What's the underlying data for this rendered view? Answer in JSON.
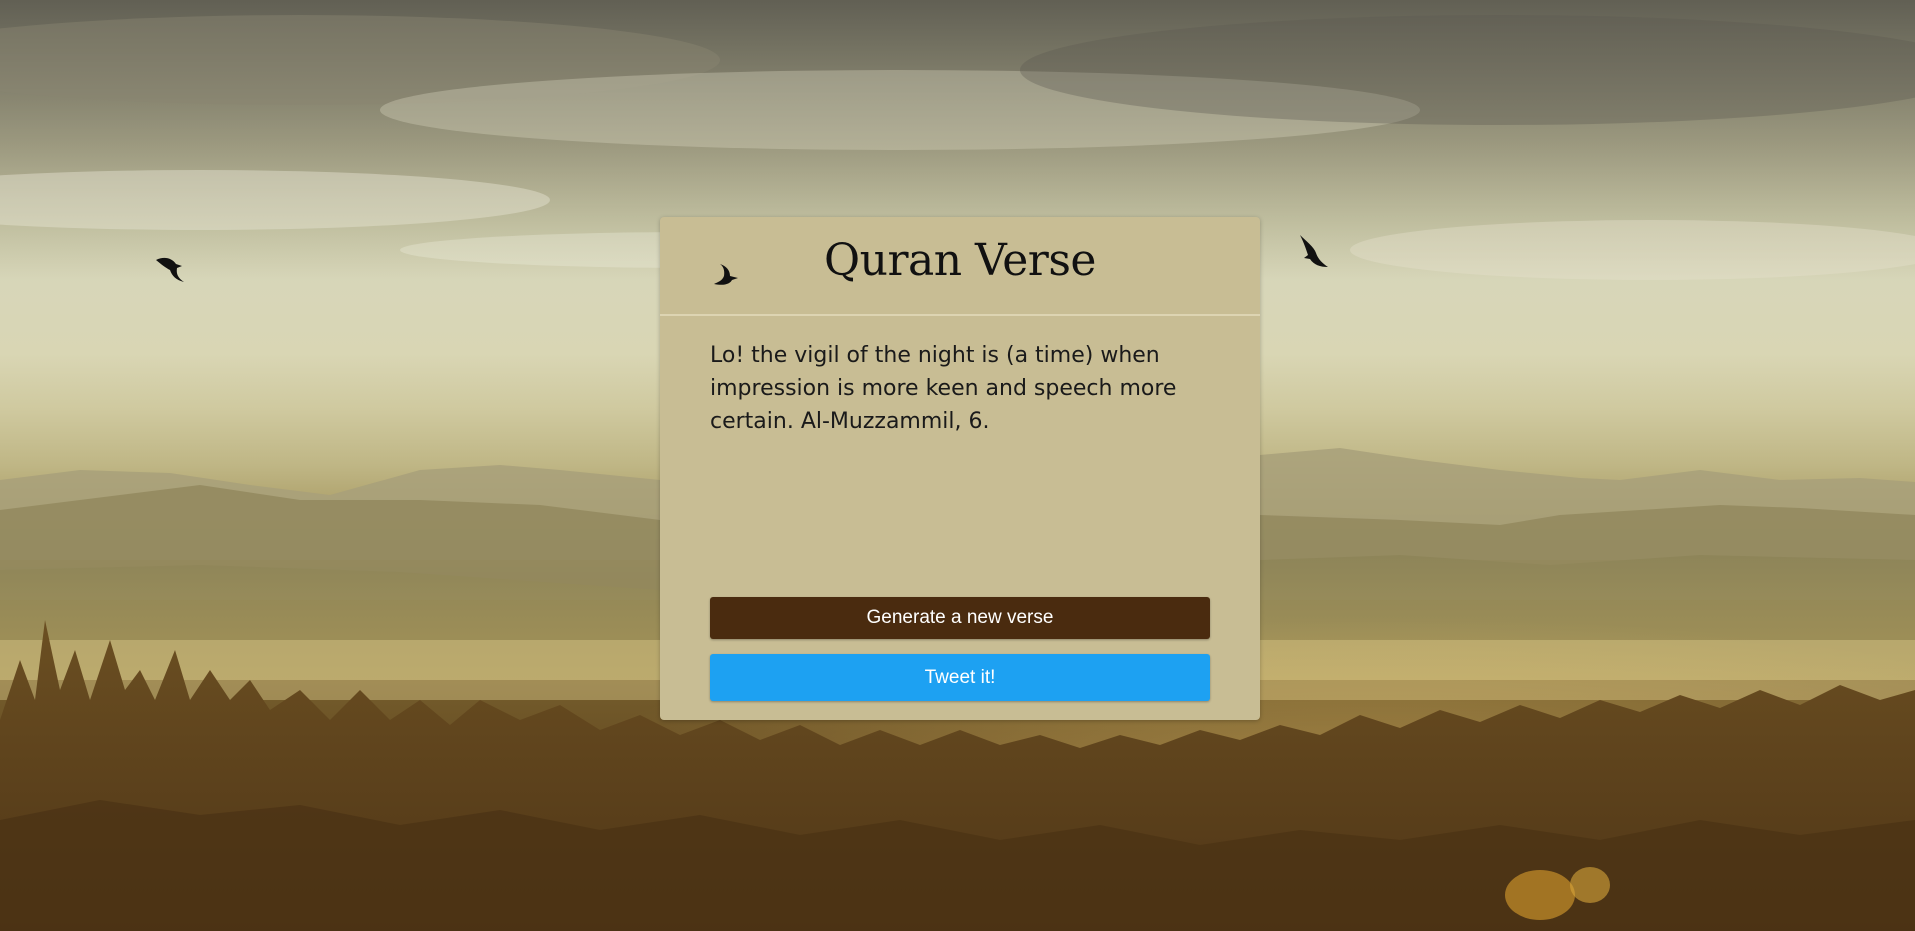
{
  "card": {
    "title": "Quran Verse",
    "verse": "Lo! the vigil of the night is (a time) when impression is more keen and speech more certain. Al-Muzzammil, 6."
  },
  "buttons": {
    "generate_label": "Generate a new verse",
    "tweet_label": "Tweet it!"
  },
  "colors": {
    "card_background": "#c8bd94",
    "generate_button": "#4a2b0f",
    "tweet_button": "#1da1f2"
  },
  "icons": [
    "bird-icon"
  ]
}
